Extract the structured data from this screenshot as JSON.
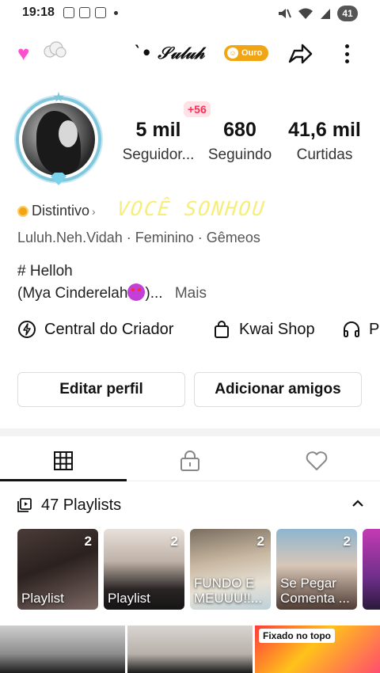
{
  "status_bar": {
    "time": "19:18",
    "battery": "41"
  },
  "header": {
    "username": "`• 𝒮𝓊𝓁𝓊𝒽",
    "badge_label": "Ouro"
  },
  "profile": {
    "new_followers": "+56",
    "stats": [
      {
        "value": "5 mil",
        "label": "Seguidor..."
      },
      {
        "value": "680",
        "label": "Seguindo"
      },
      {
        "value": "41,6 mil",
        "label": "Curtidas"
      }
    ],
    "badge_text": "Distintivo",
    "badge_chevron": "›",
    "dream_text": "VOCÊ SONHOU",
    "info": "Luluh.Neh.Vidah · Feminino · Gêmeos",
    "bio_line1": "# Helloh",
    "bio_line2": "(Mya Cinderelah",
    "bio_line2_suffix": ")...",
    "more_label": "Mais"
  },
  "shortcuts": [
    {
      "label": "Central do Criador",
      "icon": "bolt-circle-icon"
    },
    {
      "label": "Kwai Shop",
      "icon": "shopping-bag-icon"
    },
    {
      "label": "P",
      "icon": "headphones-icon"
    }
  ],
  "buttons": {
    "edit": "Editar perfil",
    "add_friends": "Adicionar amigos"
  },
  "tabs": [
    {
      "name": "grid",
      "icon": "grid-icon"
    },
    {
      "name": "private",
      "icon": "lock-icon"
    },
    {
      "name": "liked",
      "icon": "heart-outline-icon"
    }
  ],
  "playlists": {
    "title": "47 Playlists",
    "items": [
      {
        "count": "2",
        "label": "Playlist"
      },
      {
        "count": "2",
        "label": "Playlist"
      },
      {
        "count": "2",
        "label": "FUNDO E MEUUU!!..."
      },
      {
        "count": "2",
        "label": "Se Pegar Comenta ..."
      },
      {
        "count": "",
        "label": ""
      }
    ]
  },
  "videos": {
    "pinned_label": "Fixado no topo"
  },
  "colors": {
    "accent_red": "#ff2d55",
    "gold": "#f2a512",
    "dream_yellow": "#f5ee7a"
  }
}
